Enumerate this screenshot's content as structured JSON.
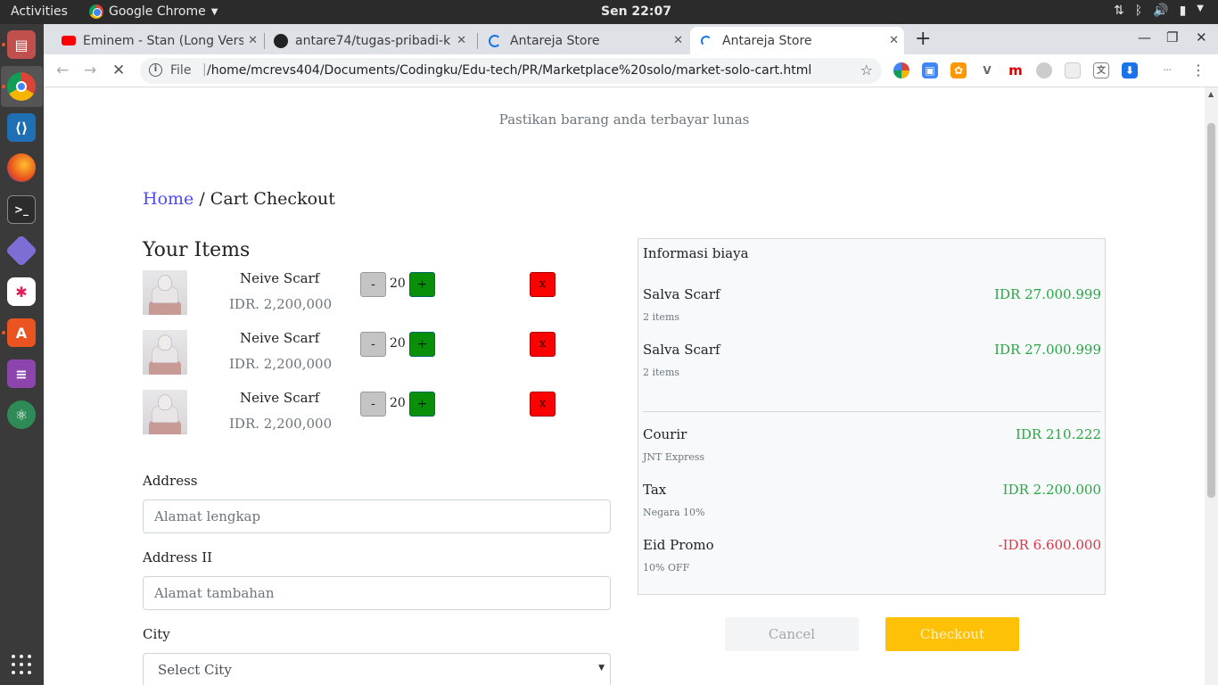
{
  "os": {
    "activities": "Activities",
    "app_name": "Google Chrome",
    "clock": "Sen 22:07"
  },
  "browser": {
    "tabs": [
      {
        "title": "Eminem - Stan (Long Vers",
        "icon": "youtube-icon"
      },
      {
        "title": "antare74/tugas-pribadi-k",
        "icon": "github-icon"
      },
      {
        "title": "Antareja Store",
        "icon": "loading-spinner-icon"
      },
      {
        "title": "Antareja Store",
        "icon": "loading-spinner-icon"
      }
    ],
    "active_tab_index": 3,
    "address": {
      "scheme_label": "File",
      "url": "/home/mcrevs404/Documents/Codingku/Edu-tech/PR/Marketplace%20solo/market-solo-cart.html"
    }
  },
  "page": {
    "notice": "Pastikan barang anda terbayar lunas",
    "breadcrumb": {
      "home": "Home",
      "separator": "/",
      "current": "Cart Checkout"
    },
    "items_title": "Your Items",
    "items": [
      {
        "name": "Neive Scarf",
        "price": "IDR. 2,200,000",
        "qty": "20",
        "minus": "-",
        "plus": "+",
        "remove": "x"
      },
      {
        "name": "Neive Scarf",
        "price": "IDR. 2,200,000",
        "qty": "20",
        "minus": "-",
        "plus": "+",
        "remove": "x"
      },
      {
        "name": "Neive Scarf",
        "price": "IDR. 2,200,000",
        "qty": "20",
        "minus": "-",
        "plus": "+",
        "remove": "x"
      }
    ],
    "form": {
      "address_label": "Address",
      "address_placeholder": "Alamat lengkap",
      "address2_label": "Address II",
      "address2_placeholder": "Alamat tambahan",
      "city_label": "City",
      "city_selected": "Select City"
    },
    "cost": {
      "title": "Informasi biaya",
      "lines": [
        {
          "name": "Salva Scarf",
          "sub": "2 items",
          "amount": "IDR 27.000.999",
          "color": "#28a745"
        },
        {
          "name": "Salva Scarf",
          "sub": "2 items",
          "amount": "IDR 27.000.999",
          "color": "#28a745"
        },
        {
          "name": "Courir",
          "sub": "JNT Express",
          "amount": "IDR 210.222",
          "color": "#28a745"
        },
        {
          "name": "Tax",
          "sub": "Negara 10%",
          "amount": "IDR 2.200.000",
          "color": "#28a745"
        },
        {
          "name": "Eid Promo",
          "sub": "10% OFF",
          "amount": "-IDR 6.600.000",
          "color": "#dc3545"
        }
      ]
    },
    "buttons": {
      "cancel": "Cancel",
      "checkout": "Checkout"
    },
    "colors": {
      "accent_checkout": "#ffc107",
      "link": "#4c4cf0",
      "plus": "#0a8f0a",
      "remove": "#ff0000"
    }
  }
}
